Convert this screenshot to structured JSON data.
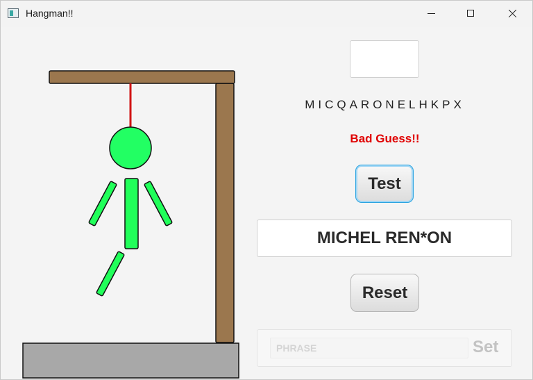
{
  "window": {
    "title": "Hangman!!",
    "controls": [
      "minimize",
      "maximize",
      "close"
    ]
  },
  "gallows": {
    "wood_color": "#9b774e",
    "base_color": "#a8a8a8",
    "rope_color": "#d11414",
    "body_color": "#21ff5a",
    "head_color": "#22ff63"
  },
  "game": {
    "guess_value": "",
    "guessed_letters": "MICQARONELHKPX",
    "status": "Bad Guess!!",
    "test_label": "Test",
    "phrase_display": "MICHEL REN*ON",
    "reset_label": "Reset",
    "phrase_placeholder": "PHRASE",
    "set_label": "Set"
  },
  "colors": {
    "status": "#e00000",
    "focus_ring": "#2aa3e0"
  }
}
